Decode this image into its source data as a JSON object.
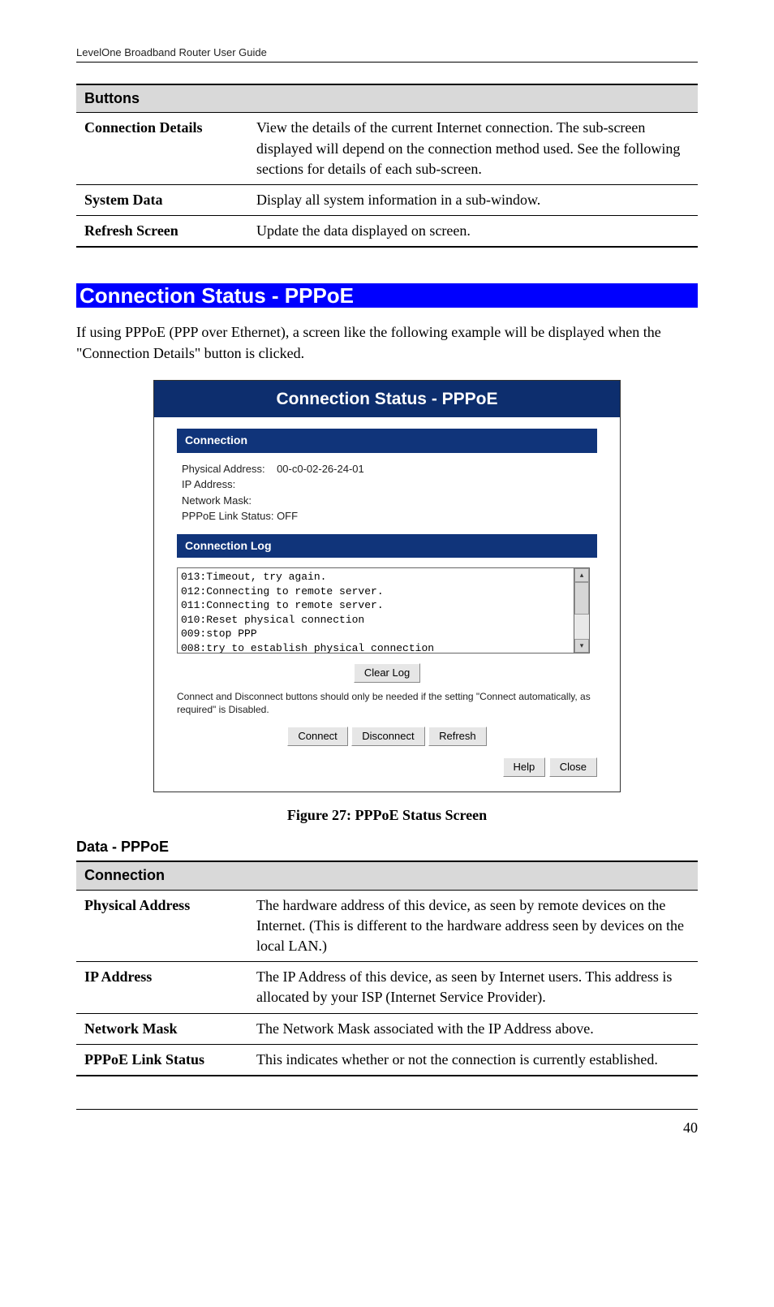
{
  "header": "LevelOne Broadband Router User Guide",
  "table1": {
    "title": "Buttons",
    "rows": [
      {
        "label": "Connection Details",
        "desc": "View the details of the current Internet connection. The sub-screen displayed will depend on the connection method used. See the following sections for details of each sub-screen."
      },
      {
        "label": "System Data",
        "desc": "Display all system information in a sub-window."
      },
      {
        "label": "Refresh Screen",
        "desc": "Update the data displayed on screen."
      }
    ]
  },
  "banner": " Connection Status - PPPoE ",
  "intro": "If using PPPoE (PPP over Ethernet), a screen like the following example will be displayed when the \"Connection Details\" button is clicked.",
  "figure": {
    "title": "Connection Status - PPPoE",
    "panel1_title": "Connection",
    "conn_lines": {
      "l1a": "Physical Address:",
      "l1b": "00-c0-02-26-24-01",
      "l2": "IP Address:",
      "l3": "Network Mask:",
      "l4": "PPPoE Link Status: OFF"
    },
    "panel2_title": "Connection Log",
    "log_text": "013:Timeout, try again.\n012:Connecting to remote server.\n011:Connecting to remote server.\n010:Reset physical connection\n009:stop PPP\n008:try to establish physical connection",
    "clear_log": "Clear Log",
    "note": "Connect and Disconnect buttons should only be needed if the setting \"Connect automatically, as required\" is Disabled.",
    "connect": "Connect",
    "disconnect": "Disconnect",
    "refresh": "Refresh",
    "help": "Help",
    "close": "Close"
  },
  "caption": "Figure 27: PPPoE Status Screen",
  "h3": "Data - PPPoE",
  "table2": {
    "title": "Connection",
    "rows": [
      {
        "label": "Physical Address",
        "desc": "The hardware address of this device, as seen by remote devices on the Internet. (This is different to the hardware address seen by devices on the local LAN.)"
      },
      {
        "label": "IP Address",
        "desc": "The IP Address of this device, as seen by Internet users. This address is allocated by your ISP (Internet Service Provider)."
      },
      {
        "label": "Network Mask",
        "desc": "The Network Mask associated with the IP Address above."
      },
      {
        "label": "PPPoE Link Status",
        "desc": "This indicates whether or not the connection is currently established."
      }
    ]
  },
  "page_num": "40"
}
